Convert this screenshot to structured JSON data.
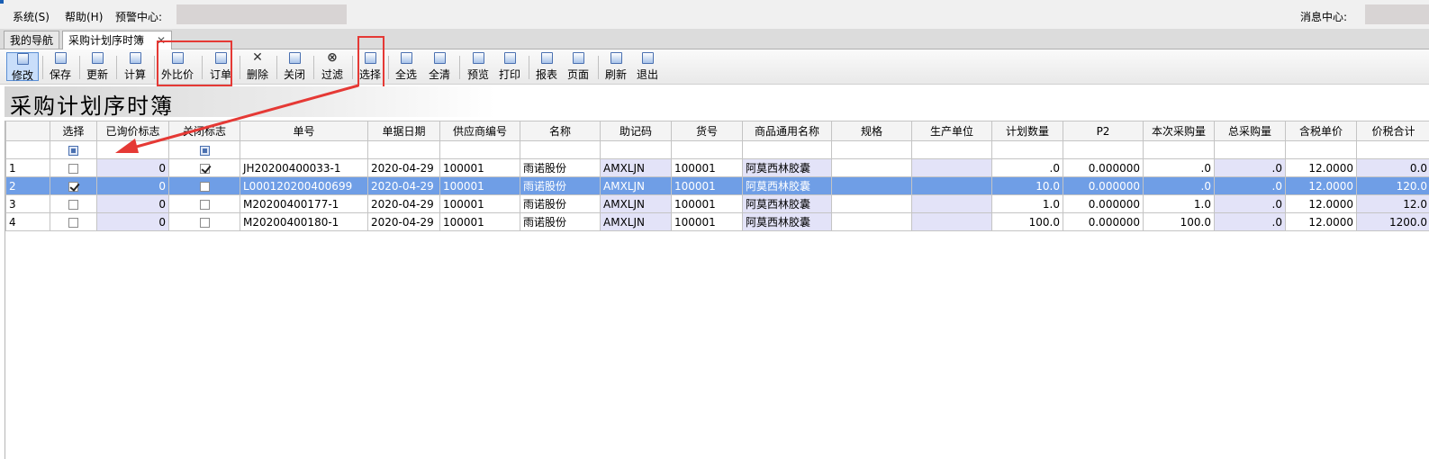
{
  "menu": {
    "system": "系统(S)",
    "help": "帮助(H)",
    "alert_center": "预警中心:",
    "message_center": "消息中心:"
  },
  "tabs": [
    {
      "label": "我的导航"
    },
    {
      "label": "采购计划序时簿",
      "close": "✕"
    }
  ],
  "toolbar": {
    "buttons": [
      {
        "label": "修改",
        "icon": "edit-icon"
      },
      {
        "label": "保存",
        "icon": "save-icon"
      },
      {
        "label": "更新",
        "icon": "refresh-doc-icon"
      },
      {
        "label": "计算",
        "icon": "calculate-icon"
      },
      {
        "label": "外比价",
        "icon": "compare-price-icon"
      },
      {
        "label": "订单",
        "icon": "order-icon"
      },
      {
        "label": "删除",
        "icon": "delete-x-icon",
        "glyph": "✕"
      },
      {
        "label": "关闭",
        "icon": "close-doc-icon"
      },
      {
        "label": "过滤",
        "icon": "binoculars-icon",
        "glyph": "⊗"
      },
      {
        "label": "选择",
        "icon": "select-icon"
      },
      {
        "label": "全选",
        "icon": "select-all-icon"
      },
      {
        "label": "全清",
        "icon": "clear-all-icon"
      },
      {
        "label": "预览",
        "icon": "preview-icon"
      },
      {
        "label": "打印",
        "icon": "print-icon"
      },
      {
        "label": "报表",
        "icon": "report-icon"
      },
      {
        "label": "页面",
        "icon": "page-icon"
      },
      {
        "label": "刷新",
        "icon": "refresh-icon"
      },
      {
        "label": "退出",
        "icon": "exit-icon"
      }
    ]
  },
  "banner": {
    "title": "采购计划序时簿"
  },
  "table": {
    "columns": [
      "选择",
      "已询价标志",
      "关闭标志",
      "单号",
      "单据日期",
      "供应商编号",
      "名称",
      "助记码",
      "货号",
      "商品通用名称",
      "规格",
      "生产单位",
      "计划数量",
      "P2",
      "本次采购量",
      "总采购量",
      "含税单价",
      "价税合计"
    ],
    "rows": [
      {
        "idx": "1",
        "select": false,
        "inquired": "0",
        "closed": true,
        "order_no": "JH20200400033-1",
        "date": "2020-04-29",
        "supplier_no": "100001",
        "name": "雨诺股份",
        "mnemonic": "AMXLJN",
        "item_no": "100001",
        "generic_name": "阿莫西林胶囊",
        "spec": "",
        "manufacturer": "",
        "plan_qty": ".0",
        "p2": "0.000000",
        "this_qty": ".0",
        "total_qty": ".0",
        "unit_price": "12.0000",
        "amount": "0.0"
      },
      {
        "idx": "2",
        "select": true,
        "inquired": "0",
        "closed": false,
        "order_no": "L000120200400699",
        "date": "2020-04-29",
        "supplier_no": "100001",
        "name": "雨诺股份",
        "mnemonic": "AMXLJN",
        "item_no": "100001",
        "generic_name": "阿莫西林胶囊",
        "spec": "",
        "manufacturer": "",
        "plan_qty": "10.0",
        "p2": "0.000000",
        "this_qty": ".0",
        "total_qty": ".0",
        "unit_price": "12.0000",
        "amount": "120.0"
      },
      {
        "idx": "3",
        "select": false,
        "inquired": "0",
        "closed": false,
        "order_no": "M20200400177-1",
        "date": "2020-04-29",
        "supplier_no": "100001",
        "name": "雨诺股份",
        "mnemonic": "AMXLJN",
        "item_no": "100001",
        "generic_name": "阿莫西林胶囊",
        "spec": "",
        "manufacturer": "",
        "plan_qty": "1.0",
        "p2": "0.000000",
        "this_qty": "1.0",
        "total_qty": ".0",
        "unit_price": "12.0000",
        "amount": "12.0"
      },
      {
        "idx": "4",
        "select": false,
        "inquired": "0",
        "closed": false,
        "order_no": "M20200400180-1",
        "date": "2020-04-29",
        "supplier_no": "100001",
        "name": "雨诺股份",
        "mnemonic": "AMXLJN",
        "item_no": "100001",
        "generic_name": "阿莫西林胶囊",
        "spec": "",
        "manufacturer": "",
        "plan_qty": "100.0",
        "p2": "0.000000",
        "this_qty": "100.0",
        "total_qty": ".0",
        "unit_price": "12.0000",
        "amount": "1200.0"
      }
    ]
  },
  "colors": {
    "selected_row": "#6f9ee6",
    "highlight_column": "#e3e3f8",
    "annotation_red": "#e53935"
  }
}
